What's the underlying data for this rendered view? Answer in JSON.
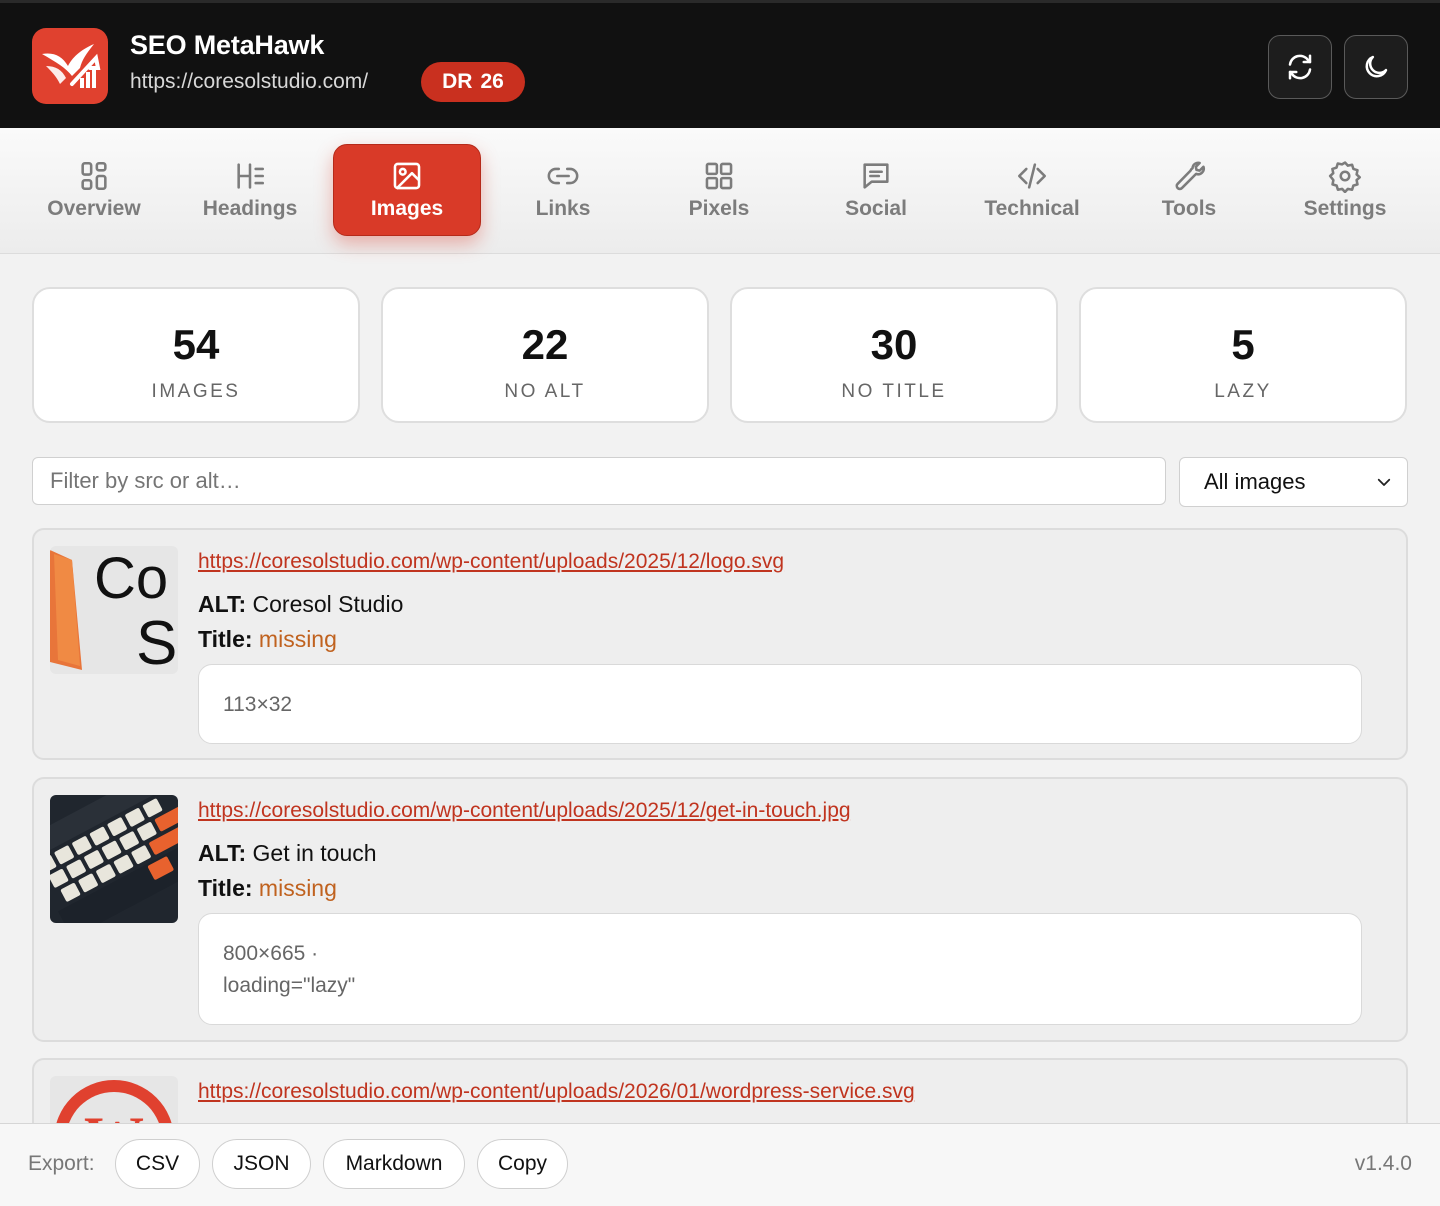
{
  "header": {
    "app_title": "SEO MetaHawk",
    "site_url": "https://coresolstudio.com/",
    "dr_label": "DR",
    "dr_value": "26",
    "refresh_icon": "refresh-icon",
    "theme_icon": "moon-icon",
    "brand_color": "#e0412f"
  },
  "tabs": [
    {
      "label": "Overview",
      "icon": "grid-icon"
    },
    {
      "label": "Headings",
      "icon": "heading-icon"
    },
    {
      "label": "Images",
      "icon": "image-icon",
      "active": true
    },
    {
      "label": "Links",
      "icon": "link-icon"
    },
    {
      "label": "Pixels",
      "icon": "pixels-icon"
    },
    {
      "label": "Social",
      "icon": "chat-icon"
    },
    {
      "label": "Technical",
      "icon": "code-icon"
    },
    {
      "label": "Tools",
      "icon": "wrench-icon"
    },
    {
      "label": "Settings",
      "icon": "gear-icon"
    }
  ],
  "stats": [
    {
      "value": "54",
      "label": "IMAGES"
    },
    {
      "value": "22",
      "label": "NO ALT"
    },
    {
      "value": "30",
      "label": "NO TITLE"
    },
    {
      "value": "5",
      "label": "LAZY"
    }
  ],
  "filter": {
    "placeholder": "Filter by src or alt…",
    "value": "",
    "select_value": "All images"
  },
  "images": [
    {
      "src": "https://coresolstudio.com/wp-content/uploads/2025/12/logo.svg",
      "alt_label": "ALT:",
      "alt": "Coresol Studio",
      "title_label": "Title:",
      "title": "missing",
      "meta_line1": "113×32",
      "meta_line2": ""
    },
    {
      "src": "https://coresolstudio.com/wp-content/uploads/2025/12/get-in-touch.jpg",
      "alt_label": "ALT:",
      "alt": "Get in touch",
      "title_label": "Title:",
      "title": "missing",
      "meta_line1": "800×665 ·",
      "meta_line2": "loading=\"lazy\""
    },
    {
      "src": "https://coresolstudio.com/wp-content/uploads/2026/01/wordpress-service.svg"
    }
  ],
  "footer": {
    "export_label": "Export:",
    "buttons": [
      "CSV",
      "JSON",
      "Markdown",
      "Copy"
    ],
    "version": "v1.4.0"
  },
  "colors": {
    "accent": "#d93a28",
    "missing": "#c0621f",
    "link": "#c0341f"
  }
}
